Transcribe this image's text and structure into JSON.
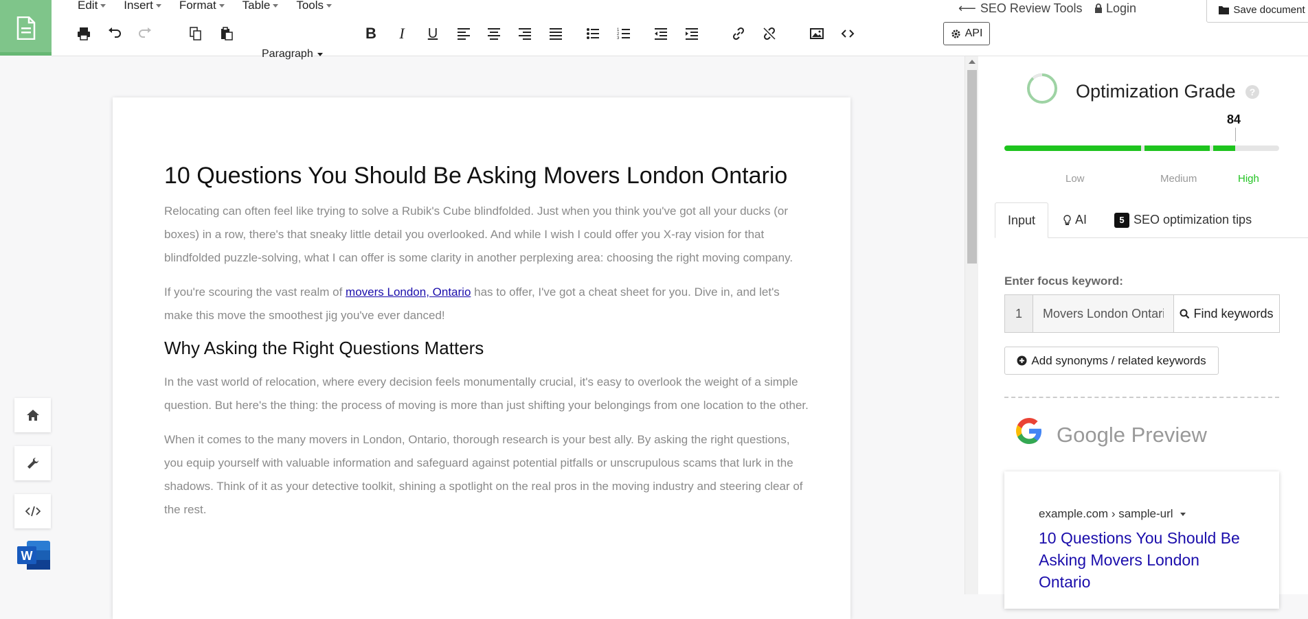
{
  "menu": [
    "Edit",
    "Insert",
    "Format",
    "Table",
    "Tools"
  ],
  "toolbar": {
    "paragraph_label": "Paragraph",
    "api_label": "API"
  },
  "header_links": {
    "seo_tools": "SEO Review Tools",
    "login": "Login",
    "save": "Save document"
  },
  "document": {
    "title": "10 Questions You Should Be Asking Movers London Ontario",
    "p1": "Relocating can often feel like trying to solve a Rubik's Cube blindfolded. Just when you think you've got all your ducks (or boxes) in a row, there's that sneaky little detail you overlooked. And while I wish I could offer you X-ray vision for that blindfolded puzzle-solving, what I can offer is some clarity in another perplexing area: choosing the right moving company.",
    "p2_before": "If you're scouring the vast realm of ",
    "p2_link": "movers London, Ontario",
    "p2_after": " has to offer, I've got a cheat sheet for you. Dive in, and let's make this move the smoothest jig you've ever danced!",
    "h2": "Why Asking the Right Questions Matters",
    "p3": "In the vast world of relocation, where every decision feels monumentally crucial, it's easy to overlook the weight of a simple question. But here's the thing: the process of moving is more than just shifting your belongings from one location to the other.",
    "p4": "When it comes to the many movers in London, Ontario, thorough research is your best ally. By asking the right questions, you equip yourself with valuable information and safeguard against potential pitfalls or unscrupulous scams that lurk in the shadows. Think of it as your detective toolkit, shining a spotlight on the real pros in the moving industry and steering clear of the rest."
  },
  "panel": {
    "grade_title": "Optimization Grade",
    "grade_value": "84",
    "grade_fraction": 0.84,
    "levels": {
      "low": "Low",
      "medium": "Medium",
      "high": "High"
    },
    "tabs": {
      "input": "Input",
      "ai": "AI",
      "tips_count": "5",
      "tips": "SEO optimization tips"
    },
    "focus_label": "Enter focus keyword:",
    "keyword_index": "1",
    "keyword_value": "Movers London Ontario",
    "find_keywords": "Find keywords",
    "add_synonyms": "Add synonyms / related keywords",
    "google_preview_title": "Google Preview",
    "preview_url": "example.com › sample-url",
    "preview_title": "10 Questions You Should Be Asking Movers London Ontario"
  },
  "colors": {
    "accent_green": "#7fc58a",
    "bar_green": "#1ec41e",
    "link_blue": "#1a0dab"
  }
}
